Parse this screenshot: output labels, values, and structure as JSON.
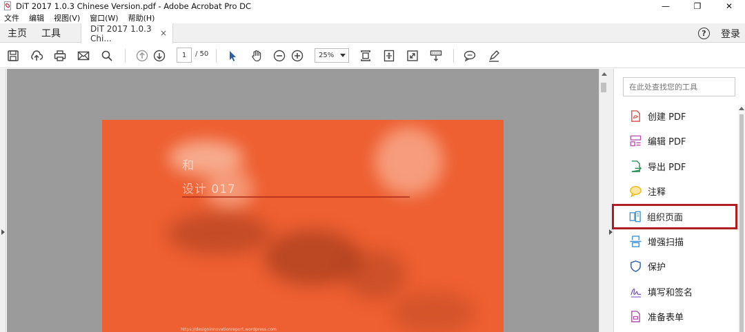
{
  "window": {
    "title": "DiT 2017 1.0.3 Chinese Version.pdf - Adobe Acrobat Pro DC",
    "controls": {
      "minimize": "—",
      "maximize": "❐",
      "close": "✕"
    }
  },
  "menu": [
    "文件",
    "编辑",
    "视图(V)",
    "窗口(W)",
    "帮助(H)"
  ],
  "nav_tabs": {
    "home": "主页",
    "tools": "工具"
  },
  "doc_tab": {
    "label": "DiT 2017 1.0.3 Chi...",
    "close": "×"
  },
  "header_right": {
    "help": "?",
    "login": "登录"
  },
  "toolbar": {
    "page_current": "1",
    "page_total": "/ 50",
    "zoom": "25%"
  },
  "pdf_page": {
    "background": "#ee5f31",
    "title_line1": "和",
    "title_line2": "设计       017",
    "url": "https://designinnovationreport.wordpress.com"
  },
  "tools_pane": {
    "search_placeholder": "在此处查找您的工具",
    "items": [
      {
        "label": "创建 PDF",
        "icon": "create-pdf-icon",
        "color": "#d9534f"
      },
      {
        "label": "编辑 PDF",
        "icon": "edit-pdf-icon",
        "color": "#b44fb0"
      },
      {
        "label": "导出 PDF",
        "icon": "export-pdf-icon",
        "color": "#2f8f5b"
      },
      {
        "label": "注释",
        "icon": "comment-icon",
        "color": "#f0b400"
      },
      {
        "label": "组织页面",
        "icon": "organize-pages-icon",
        "color": "#3b8fd6",
        "highlighted": true
      },
      {
        "label": "增强扫描",
        "icon": "enhance-scan-icon",
        "color": "#3b8fd6"
      },
      {
        "label": "保护",
        "icon": "protect-shield-icon",
        "color": "#2f5fb3"
      },
      {
        "label": "填写和签名",
        "icon": "fill-sign-icon",
        "color": "#7a5bc7"
      },
      {
        "label": "准备表单",
        "icon": "prepare-form-icon",
        "color": "#b44fb0"
      }
    ],
    "highlight_color": "#b01e23"
  }
}
